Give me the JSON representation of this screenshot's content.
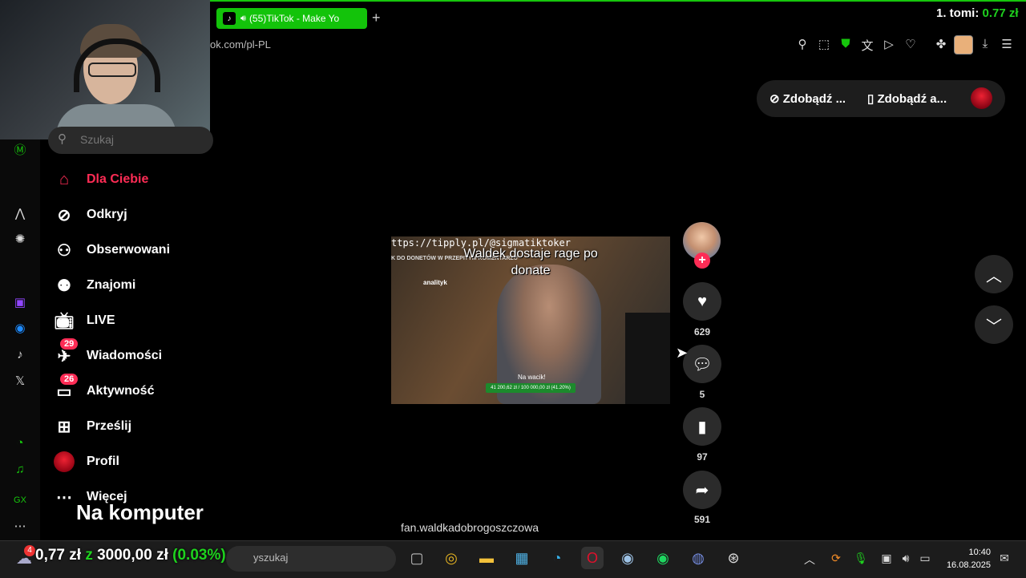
{
  "browser": {
    "tab_title": "(55)TikTok - Make Yo",
    "url_fragment": "ok.com/pl-PL",
    "new_tab": "+"
  },
  "donation": {
    "prefix": "1. tomi: ",
    "amount": "0.77 zł"
  },
  "nav": {
    "search_placeholder": "Szukaj",
    "items": [
      {
        "label": "Dla Ciebie",
        "icon": "home-icon"
      },
      {
        "label": "Odkryj",
        "icon": "compass-icon"
      },
      {
        "label": "Obserwowani",
        "icon": "following-icon"
      },
      {
        "label": "Znajomi",
        "icon": "friends-icon"
      },
      {
        "label": "LIVE",
        "icon": "live-tv-icon"
      },
      {
        "label": "Wiadomości",
        "icon": "messages-icon",
        "badge": "29"
      },
      {
        "label": "Aktywność",
        "icon": "activity-icon",
        "badge": "26"
      },
      {
        "label": "Prześlij",
        "icon": "upload-icon"
      },
      {
        "label": "Profil",
        "icon": "profile-avatar"
      },
      {
        "label": "Więcej",
        "icon": "more-icon"
      }
    ],
    "na_komputer": "Na komputer"
  },
  "top_pills": {
    "pill1": "Zdobądź ...",
    "pill2": "Zdobądź a..."
  },
  "video": {
    "caption_top": "ttps://tipply.pl/@sigmatiktoker",
    "title_line1": "Waldek dostaje rage po",
    "title_line2": "donate",
    "small_header": "K DO DONETÓW W PRZEPITYM KOMENTARZU",
    "analityk": "analityk",
    "na_wacik": "Na wacik!",
    "bar_text": "41 200,62 zł / 100 000,00 zł (41.20%)",
    "author": "fan.waldkadobrogoszczowa"
  },
  "actions": {
    "likes": "629",
    "comments": "5",
    "saves": "97",
    "shares": "591"
  },
  "taskbar": {
    "progress_amount": "0,77 zł",
    "progress_z": "z",
    "progress_goal": "3000,00 zł",
    "progress_pct": "(0.03%)",
    "search_placeholder": "yszukaj",
    "time": "10:40",
    "date": "16.08.2025",
    "notification_badge": "4"
  }
}
